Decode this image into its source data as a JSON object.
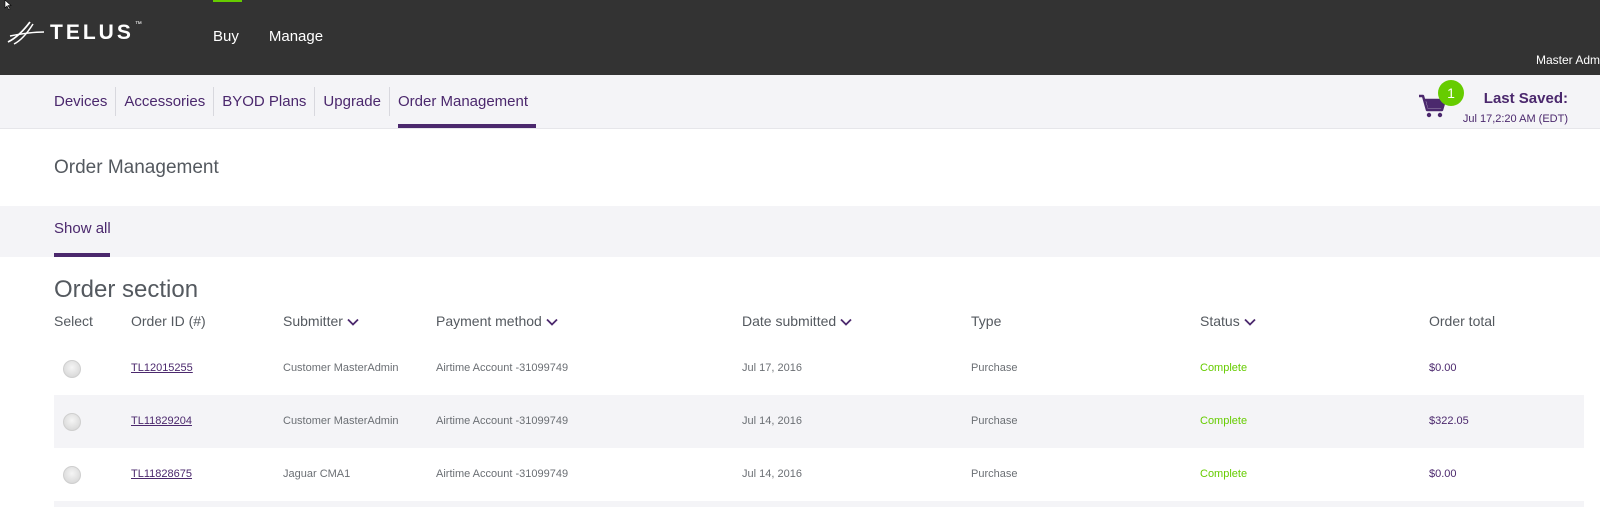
{
  "brand": {
    "logo_text": "TELUS",
    "tm": "™"
  },
  "topnav": {
    "items": [
      "Buy",
      "Manage"
    ],
    "active_index": 0
  },
  "user": {
    "label": "Master Adm"
  },
  "subnav": {
    "items": [
      "Devices",
      "Accessories",
      "BYOD Plans",
      "Upgrade",
      "Order Management"
    ],
    "active_index": 4
  },
  "cart": {
    "count": "1",
    "icon": "cart-icon"
  },
  "last_saved": {
    "title": "Last Saved:",
    "time": "Jul 17,2:20 AM (EDT)"
  },
  "page_title": "Order Management",
  "filter": {
    "show_all": "Show all"
  },
  "section_title": "Order section",
  "columns": {
    "select": "Select",
    "order_id": "Order ID (#)",
    "submitter": "Submitter",
    "payment": "Payment method",
    "date": "Date submitted",
    "type": "Type",
    "status": "Status",
    "total": "Order total"
  },
  "orders": [
    {
      "id": "TL12015255",
      "submitter": "Customer MasterAdmin",
      "payment": "Airtime Account -31099749",
      "date": "Jul 17, 2016",
      "type": "Purchase",
      "status": "Complete",
      "total": "$0.00"
    },
    {
      "id": "TL11829204",
      "submitter": "Customer MasterAdmin",
      "payment": "Airtime Account -31099749",
      "date": "Jul 14, 2016",
      "type": "Purchase",
      "status": "Complete",
      "total": "$322.05"
    },
    {
      "id": "TL11828675",
      "submitter": "Jaguar CMA1",
      "payment": "Airtime Account -31099749",
      "date": "Jul 14, 2016",
      "type": "Purchase",
      "status": "Complete",
      "total": "$0.00"
    }
  ],
  "colors": {
    "brand_purple": "#4b286d",
    "brand_green": "#66cc00",
    "topbar": "#333333"
  }
}
